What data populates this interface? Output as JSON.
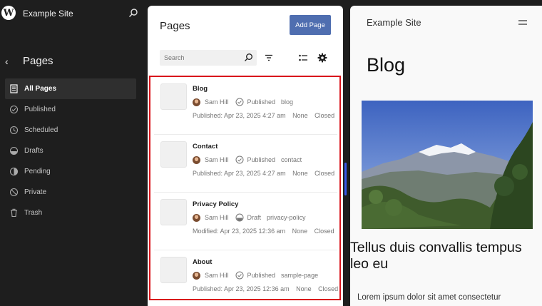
{
  "sidebar": {
    "site_name": "Example Site",
    "title": "Pages",
    "items": [
      {
        "label": "All Pages",
        "icon": "pages-icon",
        "active": true
      },
      {
        "label": "Published",
        "icon": "published-icon"
      },
      {
        "label": "Scheduled",
        "icon": "scheduled-icon"
      },
      {
        "label": "Drafts",
        "icon": "drafts-icon"
      },
      {
        "label": "Pending",
        "icon": "pending-icon"
      },
      {
        "label": "Private",
        "icon": "private-icon"
      },
      {
        "label": "Trash",
        "icon": "trash-icon"
      }
    ]
  },
  "list": {
    "title": "Pages",
    "add_label": "Add Page",
    "search_placeholder": "Search",
    "rows": [
      {
        "title": "Blog",
        "author": "Sam Hill",
        "status": "Published",
        "slug": "blog",
        "date": "Published: Apr 23, 2025 4:27 am",
        "extra1": "None",
        "extra2": "Closed"
      },
      {
        "title": "Contact",
        "author": "Sam Hill",
        "status": "Published",
        "slug": "contact",
        "date": "Published: Apr 23, 2025 4:27 am",
        "extra1": "None",
        "extra2": "Closed"
      },
      {
        "title": "Privacy Policy",
        "author": "Sam Hill",
        "status": "Draft",
        "slug": "privacy-policy",
        "date": "Modified: Apr 23, 2025 12:36 am",
        "extra1": "None",
        "extra2": "Closed"
      },
      {
        "title": "About",
        "author": "Sam Hill",
        "status": "Published",
        "slug": "sample-page",
        "date": "Published: Apr 23, 2025 12:36 am",
        "extra1": "None",
        "extra2": "Closed"
      }
    ]
  },
  "preview": {
    "site_name": "Example Site",
    "title": "Blog",
    "post_heading": "Tellus duis convallis tempus leo eu",
    "excerpt": "Lorem ipsum dolor sit amet consectetur"
  },
  "colors": {
    "accent": "#3858e9",
    "highlight_border": "#d9141b"
  }
}
